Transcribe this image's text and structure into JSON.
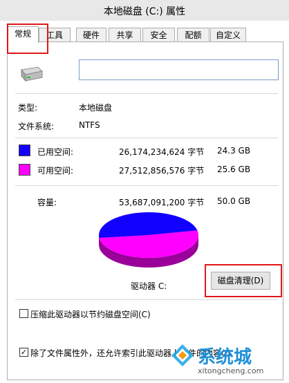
{
  "window": {
    "title": "本地磁盘 (C:) 属性"
  },
  "tabs": [
    {
      "label": "常规"
    },
    {
      "label": "工具"
    },
    {
      "label": "硬件"
    },
    {
      "label": "共享"
    },
    {
      "label": "安全"
    },
    {
      "label": "配额"
    },
    {
      "label": "自定义"
    }
  ],
  "general": {
    "name_value": "",
    "type_label": "类型:",
    "type_value": "本地磁盘",
    "fs_label": "文件系统:",
    "fs_value": "NTFS",
    "used_label": "已用空间:",
    "used_bytes": "26,174,234,624 字节",
    "used_size": "24.3 GB",
    "free_label": "可用空间:",
    "free_bytes": "27,512,856,576 字节",
    "free_size": "25.6 GB",
    "capacity_label": "容量:",
    "capacity_bytes": "53,687,091,200 字节",
    "capacity_size": "50.0 GB",
    "drive_label": "驱动器 C:",
    "cleanup_button": "磁盘清理(D)",
    "compress_label": "压缩此驱动器以节约磁盘空间(C)",
    "compress_checked": false,
    "index_label": "除了文件属性外，还允许索引此驱动器上文件的内容(I)",
    "index_checked": true
  },
  "pie": {
    "used_fraction": 0.487,
    "used_color": "#1200ff",
    "free_color": "#ff00ff"
  },
  "colors": {
    "used": "#1200ff",
    "free": "#ff00ff",
    "highlight": "#e0171a"
  },
  "watermark": {
    "brand": "系统城",
    "url": "xitongcheng.com"
  }
}
